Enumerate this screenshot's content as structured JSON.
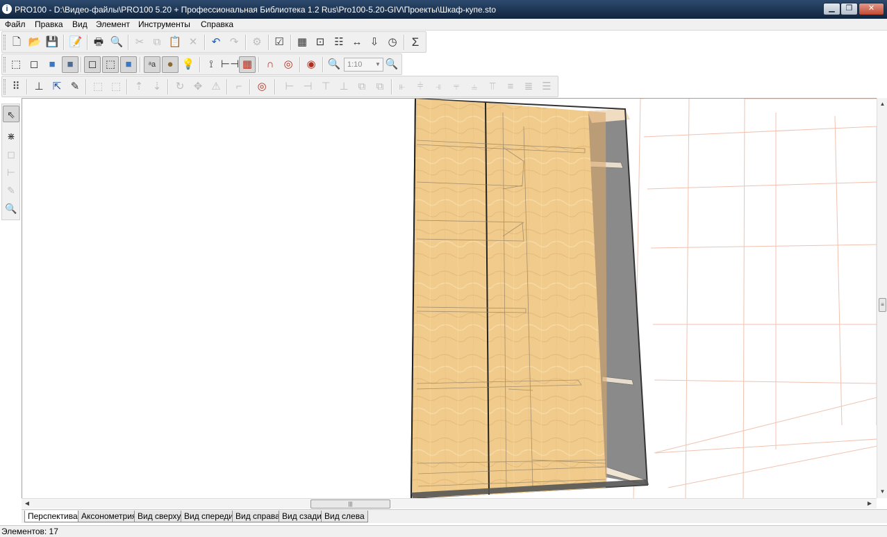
{
  "window": {
    "title": "PRO100 - D:\\Видео-файлы\\PRO100 5.20 + Профессиональная Библиотека 1.2 Rus\\Pro100-5.20-GIV\\Проекты\\Шкаф-купе.sto",
    "min_glyph": "▁",
    "max_glyph": "❐",
    "close_glyph": "✕"
  },
  "menu": [
    "Файл",
    "Правка",
    "Вид",
    "Элемент",
    "Инструменты",
    "Справка"
  ],
  "toolbar_row1": [
    "new-file",
    "open-folder",
    "save",
    "properties",
    "print",
    "print-preview",
    "cut",
    "copy",
    "paste",
    "delete",
    "undo",
    "redo",
    "group",
    "checklist",
    "library",
    "zoom-window",
    "element-list",
    "dimensions",
    "export",
    "pricing",
    "sum"
  ],
  "toolbar_row3": [
    "grid",
    "snap-to-element",
    "select-rotate",
    "pencil"
  ],
  "zoom": {
    "value": "1:10"
  },
  "left_toolbar": [
    "select-arrow",
    "section-tool",
    "box-tool",
    "dimension-tool",
    "edit-tool",
    "zoom-tool"
  ],
  "view_tabs": [
    "Перспектива",
    "Аксонометрия",
    "Вид сверху",
    "Вид спереди",
    "Вид справа",
    "Вид сзади",
    "Вид слева"
  ],
  "active_tab": "Перспектива",
  "status": {
    "elements": "Элементов: 17"
  },
  "colors": {
    "wood": "#f0cb8c",
    "wood_dark": "#dba96a",
    "grid_line": "#f0c2b0",
    "side_panel": "#8a8a8a"
  }
}
